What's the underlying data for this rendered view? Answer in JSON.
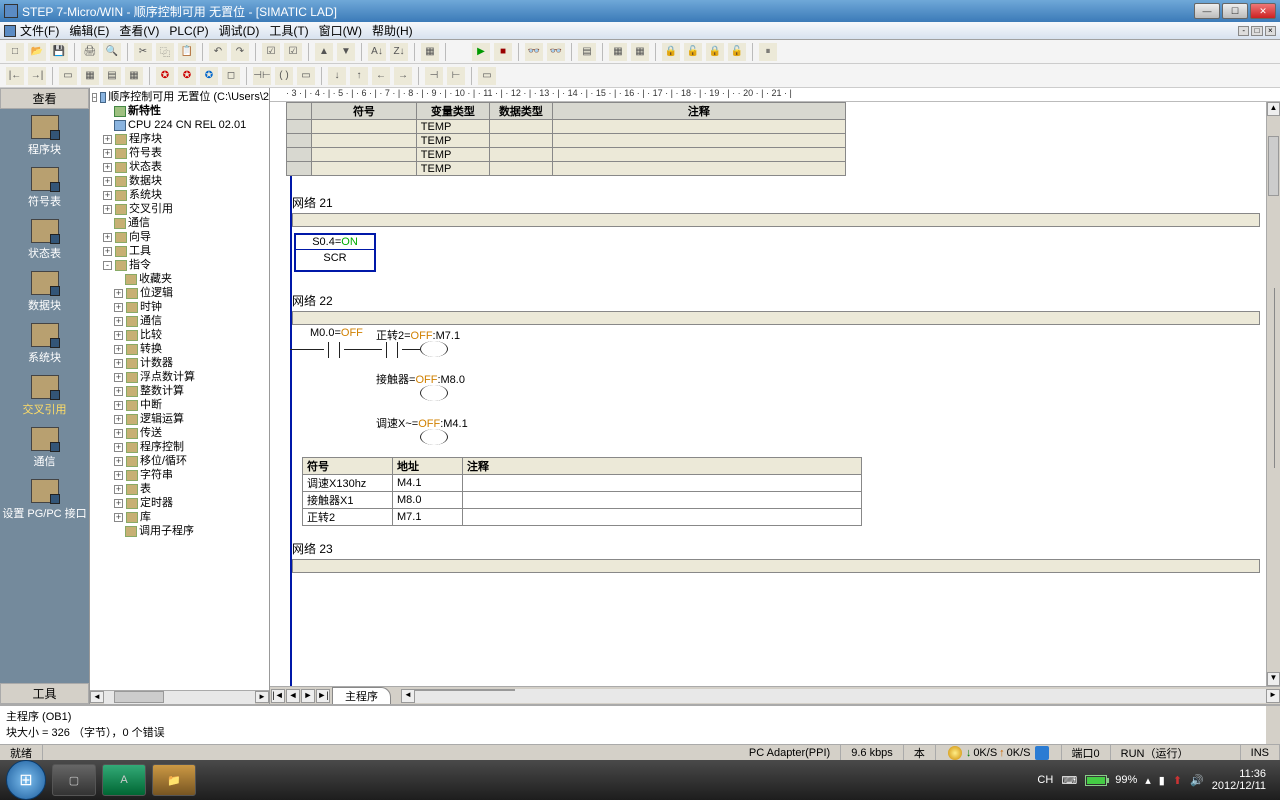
{
  "titlebar": {
    "title": "STEP 7-Micro/WIN - 顺序控制可用 无置位 - [SIMATIC LAD]"
  },
  "menu": [
    "文件(F)",
    "编辑(E)",
    "查看(V)",
    "PLC(P)",
    "调试(D)",
    "工具(T)",
    "窗口(W)",
    "帮助(H)"
  ],
  "leftnav": {
    "header": "查看",
    "items": [
      "程序块",
      "符号表",
      "状态表",
      "数据块",
      "系统块",
      "交叉引用",
      "通信",
      "设置 PG/PC 接口"
    ],
    "footer": "工具"
  },
  "tree": {
    "root": "顺序控制可用 无置位 (C:\\Users\\2",
    "l1": [
      {
        "t": "新特性",
        "bold": true,
        "ic": "gn",
        "leaf": true
      },
      {
        "t": "CPU 224 CN REL 02.01",
        "ic": "blue",
        "leaf": true
      },
      {
        "t": "程序块",
        "exp": "+"
      },
      {
        "t": "符号表",
        "exp": "+"
      },
      {
        "t": "状态表",
        "exp": "+"
      },
      {
        "t": "数据块",
        "exp": "+"
      },
      {
        "t": "系统块",
        "exp": "+"
      },
      {
        "t": "交叉引用",
        "exp": "+"
      },
      {
        "t": "通信",
        "leaf": true
      },
      {
        "t": "向导",
        "exp": "+"
      },
      {
        "t": "工具",
        "exp": "+"
      }
    ],
    "inst": "指令",
    "l2": [
      {
        "t": "收藏夹",
        "leaf": true
      },
      {
        "t": "位逻辑",
        "exp": "+"
      },
      {
        "t": "时钟",
        "exp": "+"
      },
      {
        "t": "通信",
        "exp": "+"
      },
      {
        "t": "比较",
        "exp": "+"
      },
      {
        "t": "转换",
        "exp": "+"
      },
      {
        "t": "计数器",
        "exp": "+"
      },
      {
        "t": "浮点数计算",
        "exp": "+"
      },
      {
        "t": "整数计算",
        "exp": "+"
      },
      {
        "t": "中断",
        "exp": "+"
      },
      {
        "t": "逻辑运算",
        "exp": "+"
      },
      {
        "t": "传送",
        "exp": "+"
      },
      {
        "t": "程序控制",
        "exp": "+"
      },
      {
        "t": "移位/循环",
        "exp": "+"
      },
      {
        "t": "字符串",
        "exp": "+"
      },
      {
        "t": "表",
        "exp": "+"
      },
      {
        "t": "定时器",
        "exp": "+"
      },
      {
        "t": "库",
        "exp": "+"
      },
      {
        "t": "调用子程序",
        "leaf": true
      }
    ]
  },
  "ruler": "· 3 · | · 4 · | · 5 · | · 6 · | · 7 · | · 8 · | · 9 · | · 10 · | · 11 · | · 12 · | · 13 · | · 14 · | · 15 · | · 16 · | · 17 · | · 18 · | · 19 · | · · 20 · | · 21 · |",
  "vartable": {
    "headers": [
      "",
      "符号",
      "变量类型",
      "数据类型",
      "注释"
    ],
    "rows": [
      [
        "",
        "",
        "TEMP",
        "",
        ""
      ],
      [
        "",
        "",
        "TEMP",
        "",
        ""
      ],
      [
        "",
        "",
        "TEMP",
        "",
        ""
      ],
      [
        "",
        "",
        "TEMP",
        "",
        ""
      ]
    ]
  },
  "nets": {
    "n21": {
      "title": "网络 21",
      "scr_top": "S0.4=",
      "scr_on": "ON",
      "scr_name": "SCR"
    },
    "n22": {
      "title": "网络 22",
      "c1_pre": "M0.0=",
      "c1_off": "OFF",
      "c2_pre": "正转2=",
      "c2_off": "OFF",
      "c2_suf": ":M7.1",
      "o2_pre": "接触器=",
      "o2_off": "OFF",
      "o2_suf": ":M8.0",
      "o3_pre": "调速X~=",
      "o3_off": "OFF",
      "o3_suf": ":M4.1"
    },
    "n23": {
      "title": "网络 23"
    }
  },
  "symtable": {
    "headers": [
      "符号",
      "地址",
      "注释"
    ],
    "rows": [
      [
        "调速X130hz",
        "M4.1",
        ""
      ],
      [
        "接触器X1",
        "M8.0",
        ""
      ],
      [
        "正转2",
        "M7.1",
        ""
      ]
    ]
  },
  "tabs": {
    "main": "主程序"
  },
  "output": {
    "l1": "主程序 (OB1)",
    "l2": "块大小 = 326 （字节），0 个错误"
  },
  "status": {
    "ready": "就绪",
    "adapter": "PC Adapter(PPI)",
    "baud": "9.6 kbps",
    "b": "本",
    "r1": "0K/S",
    "r2": "0K/S",
    "port": "端口0",
    "run": "RUN（运行）",
    "ins": "INS"
  },
  "tray": {
    "batt": "99%",
    "lang": "CH",
    "time": "11:36",
    "date": "2012/12/11"
  }
}
